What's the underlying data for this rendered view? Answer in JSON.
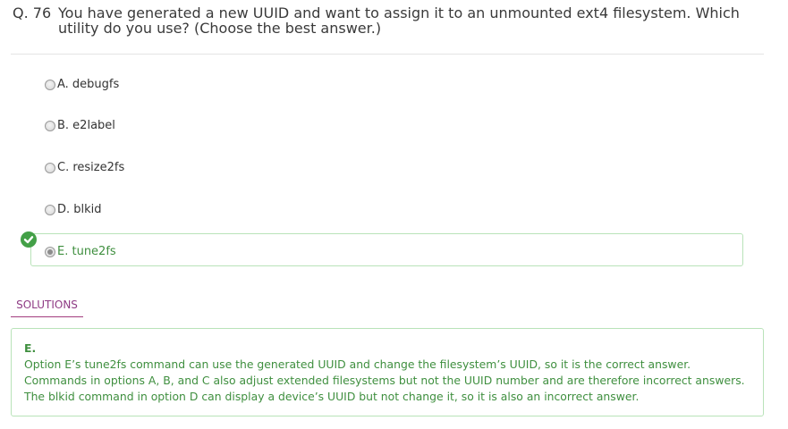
{
  "question": {
    "number": "Q. 76",
    "text": "You have generated a new UUID and want to assign it to an unmounted ext4 filesystem. Which utility do you use? (Choose the best answer.)"
  },
  "options": [
    {
      "label": "A. debugfs",
      "checked": false,
      "correct": false
    },
    {
      "label": "B. e2label",
      "checked": false,
      "correct": false
    },
    {
      "label": "C. resize2fs",
      "checked": false,
      "correct": false
    },
    {
      "label": "D. blkid",
      "checked": false,
      "correct": false
    },
    {
      "label": "E. tune2fs",
      "checked": true,
      "correct": true
    }
  ],
  "solutions": {
    "tab_label": "SOLUTIONS",
    "answer": "E.",
    "explanation": "Option E’s tune2fs command can use the generated UUID and change the filesystem’s UUID, so it is the correct answer. Commands in options A, B, and C also adjust extended filesystems but not the UUID number and are therefore incorrect answers. The blkid command in option D can display a device’s UUID but not change it, so it is also an incorrect answer."
  },
  "icons": {
    "correct_marker": "check-circle-icon"
  },
  "colors": {
    "correct_green": "#3f8f3f",
    "badge_green": "#43a047",
    "solutions_accent": "#a23c7e"
  }
}
